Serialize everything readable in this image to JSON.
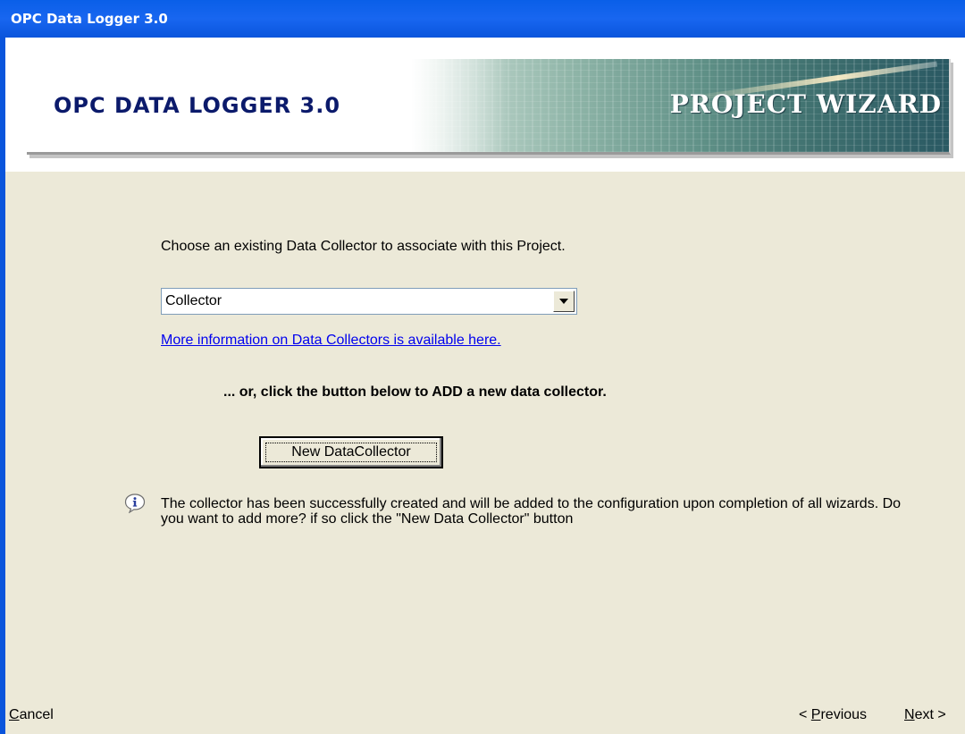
{
  "window": {
    "title": "OPC Data Logger 3.0"
  },
  "banner": {
    "title": "OPC DATA LOGGER 3.0",
    "subtitle": "PROJECT WIZARD"
  },
  "content": {
    "prompt": "Choose an existing Data Collector to associate with this Project.",
    "collector_select": {
      "value": "Collector"
    },
    "info_link": "More information on Data Collectors is available here.",
    "or_text": "... or, click the button below to ADD a new data collector.",
    "new_button_label": "New DataCollector",
    "info_icon": "info-speech-bubble-icon",
    "info_message": "The collector has been successfully created and will be added to the configuration upon completion of all wizards. Do you want to add more? if so click the \"New Data Collector\" button"
  },
  "footer": {
    "cancel": {
      "accel": "C",
      "rest": "ancel"
    },
    "previous": {
      "pre": "< ",
      "accel": "P",
      "rest": "revious"
    },
    "next": {
      "accel": "N",
      "rest": "ext >"
    }
  },
  "colors": {
    "titlebar": "#0a55dc",
    "dialog_bg": "#ece9d8",
    "banner_title": "#0b1a6b",
    "link": "#0000ee"
  }
}
